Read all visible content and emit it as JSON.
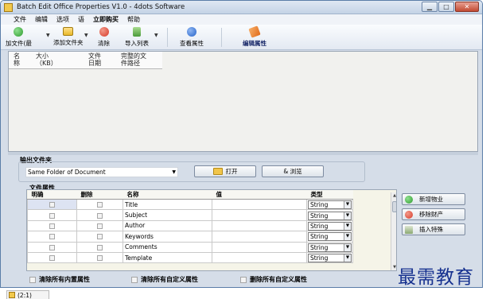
{
  "window": {
    "title": "Batch Edit Office Properties V1.0 - 4dots Software",
    "minimize": "▁",
    "maximize": "□",
    "close": "✕"
  },
  "menu": [
    {
      "label": "文件",
      "bold": false
    },
    {
      "label": "编辑",
      "bold": false
    },
    {
      "label": "选项",
      "bold": false
    },
    {
      "label": "语",
      "bold": false
    },
    {
      "label": "立即购买",
      "bold": true
    },
    {
      "label": "帮助",
      "bold": false
    }
  ],
  "toolbar": {
    "add_file": {
      "label": "加文件(最",
      "icon": "add-icon",
      "color": "#2e9b2e"
    },
    "add_folder": {
      "label": "添加文件夹",
      "icon": "folder-icon",
      "color": "#e8b92a"
    },
    "clear": {
      "label": "清除",
      "icon": "clear-icon",
      "color": "#d73a2a"
    },
    "import_list": {
      "label": "导入列表",
      "icon": "import-icon",
      "color": "#4a9a3a"
    },
    "view_props": {
      "label": "查看属性",
      "icon": "info-icon",
      "color": "#2563c9"
    },
    "edit_props": {
      "label": "编辑属性",
      "icon": "edit-properties-icon",
      "color": "#e06a1a"
    }
  },
  "file_list": {
    "columns": [
      "名\n称",
      "大小\n（KB）",
      "文件\n日期",
      "完整的文\n件路径"
    ]
  },
  "output": {
    "label": "输出文件夹",
    "folder_value": "Same Folder of Document",
    "open_button": "打开",
    "browse_button": "& 浏览"
  },
  "properties": {
    "label": "文件属性",
    "columns": [
      "明确",
      "删除",
      "名称",
      "值",
      "类型"
    ],
    "rows": [
      {
        "name": "Title",
        "value": "",
        "type": "String"
      },
      {
        "name": "Subject",
        "value": "",
        "type": "String"
      },
      {
        "name": "Author",
        "value": "",
        "type": "String"
      },
      {
        "name": "Keywords",
        "value": "",
        "type": "String"
      },
      {
        "name": "Comments",
        "value": "",
        "type": "String"
      },
      {
        "name": "Template",
        "value": "",
        "type": "String"
      }
    ]
  },
  "side_buttons": {
    "add_property": "新增物业",
    "remove_property": "移除财产",
    "insert_special": "插入特殊"
  },
  "bottom_options": {
    "clear_builtin": "清除所有内置属性",
    "clear_custom": "清除所有自定义属性",
    "delete_custom": "删除所有自定义属性"
  },
  "watermark": "最需教育",
  "taskbar": {
    "label": "(2:1)"
  }
}
